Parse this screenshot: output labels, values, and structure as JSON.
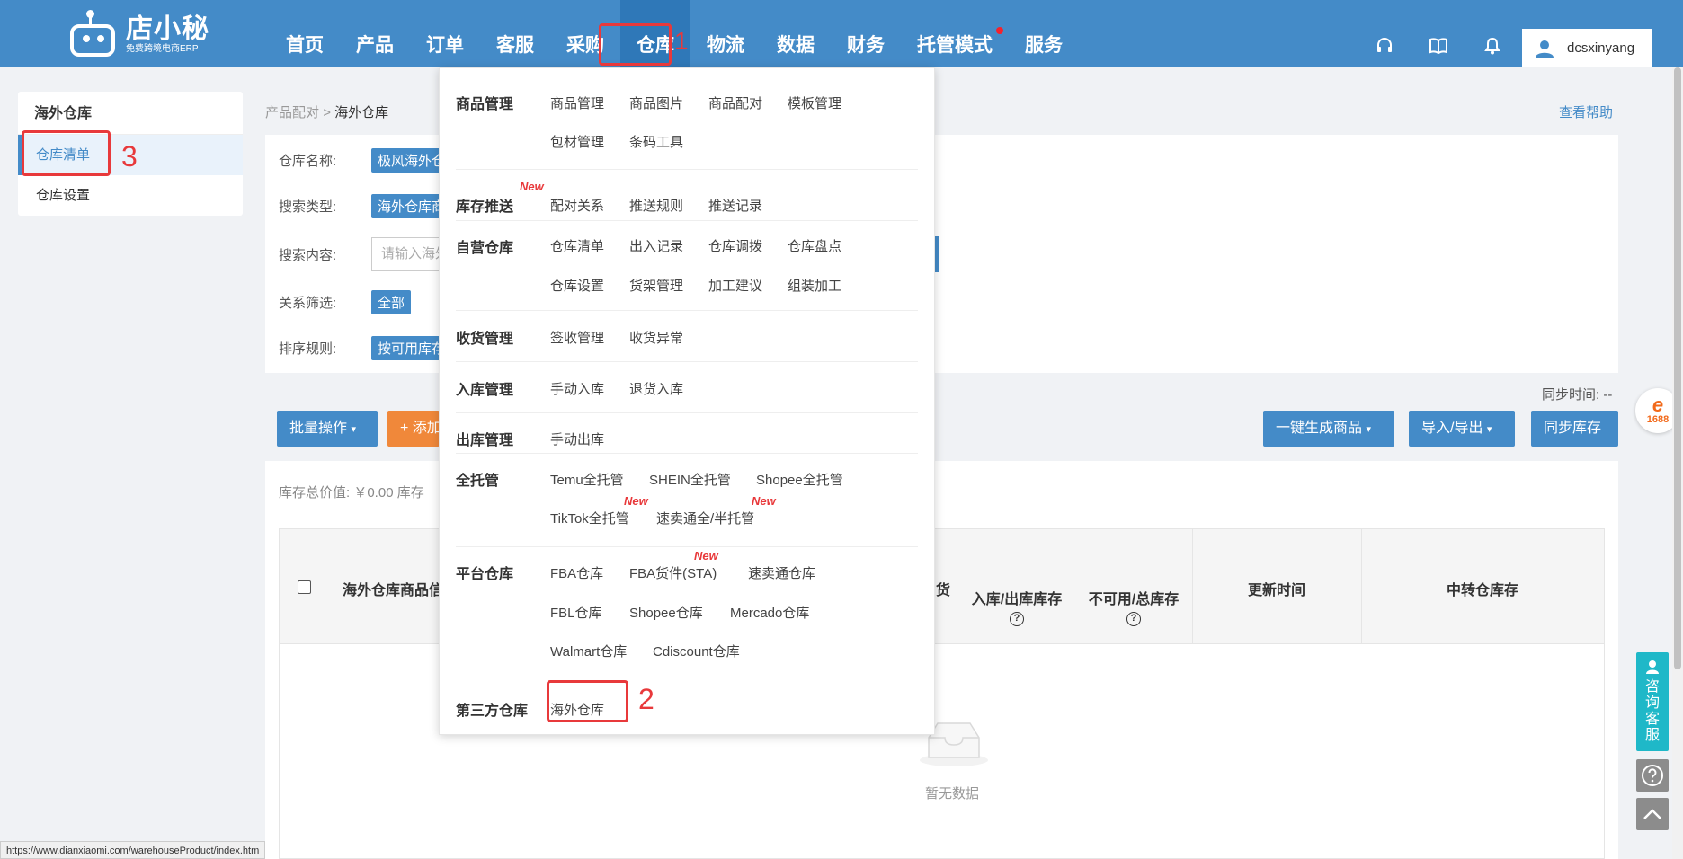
{
  "app": {
    "logo_name": "店小秘",
    "logo_tagline": "免费跨境电商ERP"
  },
  "nav": [
    {
      "label": "首页"
    },
    {
      "label": "产品"
    },
    {
      "label": "订单"
    },
    {
      "label": "客服"
    },
    {
      "label": "采购"
    },
    {
      "label": "仓库"
    },
    {
      "label": "物流"
    },
    {
      "label": "数据"
    },
    {
      "label": "财务"
    },
    {
      "label": "托管模式"
    },
    {
      "label": "服务"
    }
  ],
  "header_icons": [
    "headset-icon",
    "book-icon",
    "bell-icon"
  ],
  "user": {
    "name": "dcsxinyang"
  },
  "annotations": {
    "n1": "1",
    "n2": "2",
    "n3": "3"
  },
  "sidebar": {
    "title": "海外仓库",
    "items": [
      {
        "label": "仓库清单"
      },
      {
        "label": "仓库设置"
      }
    ]
  },
  "breadcrumb": {
    "parent": "产品配对",
    "sep": ">",
    "current": "海外仓库"
  },
  "help": "查看帮助",
  "filters": {
    "warehouse_label": "仓库名称:",
    "warehouse_value": "极风海外仓",
    "search_type_label": "搜索类型:",
    "search_type_value": "海外仓库商品",
    "search_content_label": "搜索内容:",
    "search_placeholder": "请输入海外",
    "relation_label": "关系筛选:",
    "relation_value": "全部",
    "sort_label": "排序规则:",
    "sort_value": "按可用库存"
  },
  "sync_time": "同步时间: --",
  "buttons": {
    "batch": "批量操作",
    "add": "+ 添加",
    "generate": "一键生成商品",
    "import_export": "导入/导出",
    "sync_stock": "同步库存"
  },
  "stock_value": "库存总价值: ￥0.00 库存",
  "table": {
    "headers": {
      "product": "海外仓库商品信",
      "goods_partial": "货",
      "in_out": "入库/出库库存",
      "unavailable": "不可用/总库存",
      "updated": "更新时间",
      "transit": "中转仓库存"
    },
    "help_glyph": "?",
    "empty": "暂无数据"
  },
  "dropdown": {
    "new_label": "New",
    "sections": [
      {
        "category": "商品管理",
        "items": [
          "商品管理",
          "商品图片",
          "商品配对",
          "模板管理",
          "包材管理",
          "条码工具"
        ]
      },
      {
        "category": "库存推送",
        "items": [
          "配对关系",
          "推送规则",
          "推送记录"
        ]
      },
      {
        "category": "自营仓库",
        "items": [
          "仓库清单",
          "出入记录",
          "仓库调拨",
          "仓库盘点",
          "仓库设置",
          "货架管理",
          "加工建议",
          "组装加工"
        ]
      },
      {
        "category": "收货管理",
        "items": [
          "签收管理",
          "收货异常"
        ]
      },
      {
        "category": "入库管理",
        "items": [
          "手动入库",
          "退货入库"
        ]
      },
      {
        "category": "出库管理",
        "items": [
          "手动出库"
        ]
      },
      {
        "category": "全托管",
        "items": [
          "Temu全托管",
          "SHEIN全托管",
          "Shopee全托管",
          "TikTok全托管",
          "速卖通全/半托管"
        ]
      },
      {
        "category": "平台仓库",
        "items": [
          "FBA仓库",
          "FBA货件(STA)",
          "速卖通仓库",
          "FBL仓库",
          "Shopee仓库",
          "Mercado仓库",
          "Walmart仓库",
          "Cdiscount仓库"
        ]
      },
      {
        "category": "第三方仓库",
        "items": [
          "海外仓库"
        ]
      }
    ]
  },
  "float": {
    "ali_text": "1688",
    "ali_glyph": "e",
    "consult": [
      "咨",
      "询",
      "客",
      "服"
    ]
  },
  "status_url": "https://www.dianxiaomi.com/warehouseProduct/index.htm"
}
